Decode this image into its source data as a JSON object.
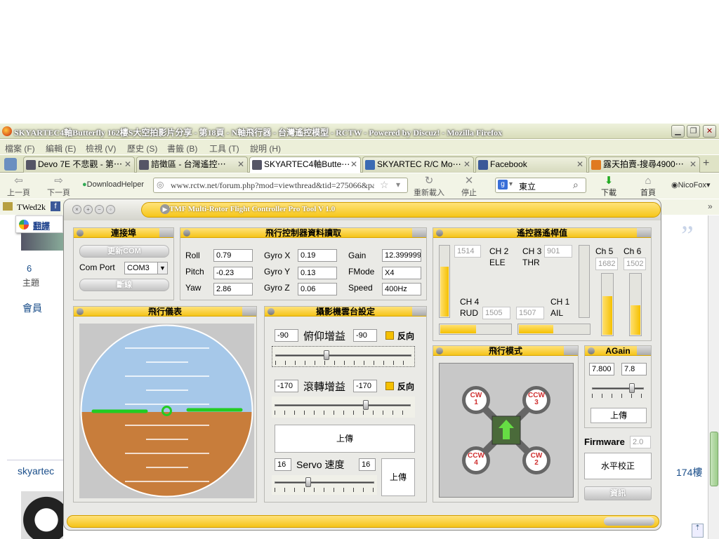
{
  "browser": {
    "title": "SKYARTEC4軸Butterfly 162樓S大空拍影片分享 - 第18頁 - N軸飛行器 - 台灣遙控模型 - RCTW - Powered by Discuz! - Mozilla Firefox",
    "menus": [
      "檔案 (F)",
      "編輯 (E)",
      "檢視 (V)",
      "歷史 (S)",
      "書籤 (B)",
      "工具 (T)",
      "說明 (H)"
    ],
    "tabs": [
      "Devo 7E 不悲觀 - 第⋯",
      "諮徵區 - 台灣遙控⋯",
      "SKYARTEC4軸Butte⋯",
      "SKYARTEC R/C Mo⋯",
      "Facebook",
      "露天拍賣-搜尋4900⋯"
    ],
    "nav": {
      "back": "上一頁",
      "forward": "下一頁",
      "downloadhelper": "DownloadHelper",
      "reload": "重新載入",
      "stop": "停止",
      "download": "下載",
      "home": "首頁",
      "user": "NicoFox"
    },
    "url": "www.rctw.net/forum.php?mod=viewthread&tid=275066&page",
    "search_value": "東立",
    "bookmark": "TWed2k",
    "translate": "翻譯"
  },
  "page": {
    "count": "6",
    "count_label": "主題",
    "member": "會員",
    "author": "skyartec",
    "floor": "174樓",
    "quote_mark": "”"
  },
  "app": {
    "title": "TMF Multi-Rotor Flight Controller Pro Tool V 1.0",
    "port": {
      "header": "連接埠",
      "refresh": "更新COM",
      "label": "Com Port",
      "value": "COM3",
      "disconnect": "斷線"
    },
    "fc": {
      "header": "飛行控制器資料讀取",
      "rows": [
        {
          "l1": "Roll",
          "v1": "0.79",
          "l2": "Gyro X",
          "v2": "0.19",
          "l3": "Gain",
          "v3": "12.399999"
        },
        {
          "l1": "Pitch",
          "v1": "-0.23",
          "l2": "Gyro Y",
          "v2": "0.13",
          "l3": "FMode",
          "v3": "X4"
        },
        {
          "l1": "Yaw",
          "v1": "2.86",
          "l2": "Gyro Z",
          "v2": "0.06",
          "l3": "Speed",
          "v3": "400Hz"
        }
      ]
    },
    "rc": {
      "header": "遙控器遙桿值",
      "ch2": "CH 2",
      "ele": "ELE",
      "ch3": "CH 3",
      "thr": "THR",
      "ch4": "CH 4",
      "rud": "RUD",
      "ch1": "CH 1",
      "ail": "AIL",
      "ch5": "Ch 5",
      "ch6": "Ch 6",
      "v_left": "1514",
      "v_ch3": "901",
      "v_ch4": "1505",
      "v_ch1": "1507",
      "v_ch5": "1682",
      "v_ch6": "1502",
      "lvl_left": 0.7,
      "lvl_ch5": 0.62,
      "lvl_ch6": 0.48,
      "lvl_rud": 0.5,
      "lvl_ail": 0.48
    },
    "attitude": {
      "header": "飛行儀表"
    },
    "gimbal": {
      "header": "攝影機雲台設定",
      "pitch_min": "-90",
      "pitch_label": "俯仰增益",
      "pitch_max": "-90",
      "pitch_reverse": "反向",
      "roll_min": "-170",
      "roll_label": "滾轉增益",
      "roll_max": "-170",
      "roll_reverse": "反向",
      "upload": "上傳",
      "servo_min": "16",
      "servo_label": "Servo 速度",
      "servo_max": "16",
      "servo_upload": "上傳",
      "pitch_slider": 0.37,
      "roll_slider": 0.67,
      "servo_slider": 0.33
    },
    "mode": {
      "header": "飛行模式",
      "m1": "CW",
      "n1": "1",
      "m2": "CCW",
      "n2": "3",
      "m3": "CCW",
      "n3": "4",
      "m4": "CW",
      "n4": "2"
    },
    "again": {
      "header": "AGain",
      "v1": "7.800",
      "v2": "7.8",
      "upload": "上傳",
      "slider": 0.8
    },
    "firmware": {
      "label": "Firmware",
      "value": "2.0",
      "level": "水平校正",
      "info": "資訊"
    }
  }
}
